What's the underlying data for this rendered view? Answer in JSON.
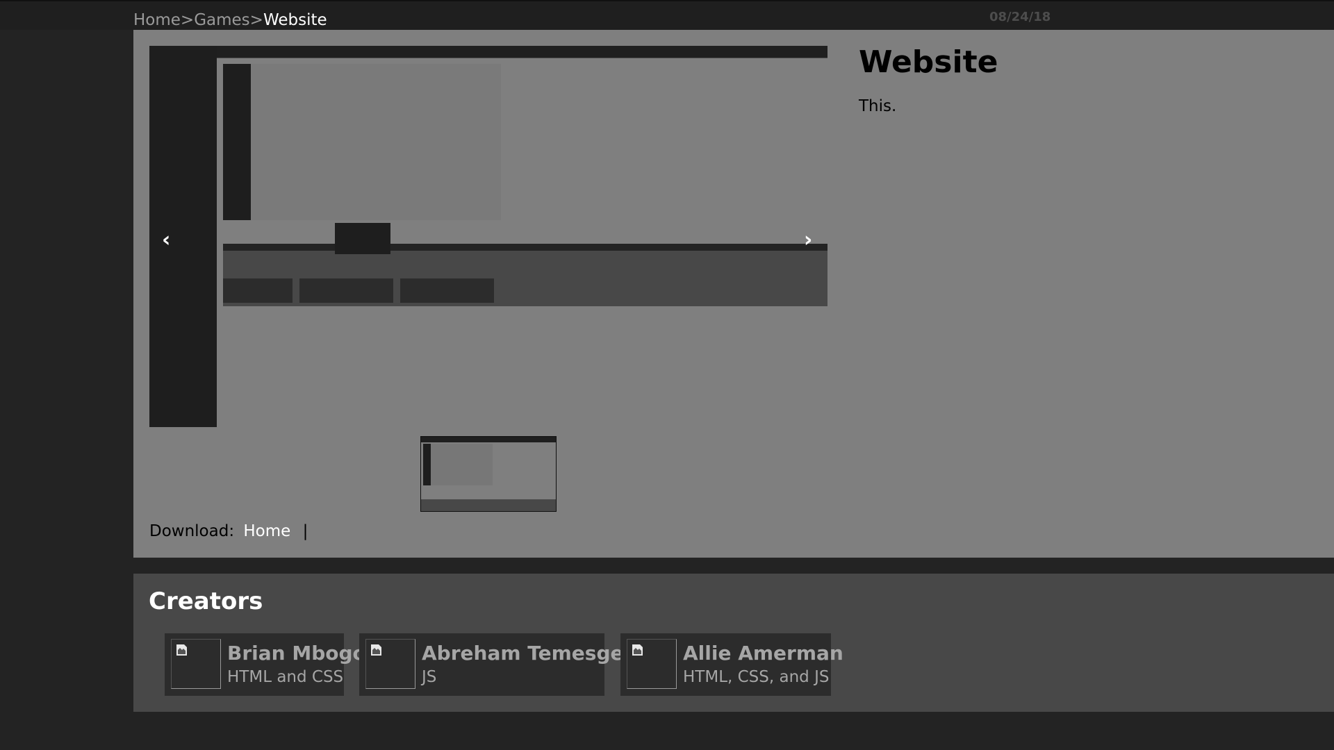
{
  "breadcrumb": {
    "home": "Home",
    "sep1": ">",
    "games": "Games",
    "sep2": ">",
    "current": "Website"
  },
  "date": "08/24/18",
  "carousel": {
    "prev": "‹",
    "next": "›"
  },
  "item": {
    "title": "Website",
    "description": "This."
  },
  "download": {
    "label": "Download:",
    "link": "Home",
    "separator": "|"
  },
  "creators": {
    "heading": "Creators",
    "people": [
      {
        "name": "Brian Mbogo",
        "role": "HTML and CSS"
      },
      {
        "name": "Abreham Temesgen",
        "role": "JS"
      },
      {
        "name": "Allie Amerman",
        "role": "HTML, CSS, and JS"
      }
    ]
  },
  "colors": {
    "page_bg": "#232323",
    "panel_bg": "#7f7f7f",
    "creators_bg": "#484848",
    "card_bg": "#2c2c2c",
    "link": "#ffffff"
  },
  "icons": {
    "carousel_prev": "chevron-left-icon",
    "carousel_next": "chevron-right-icon",
    "avatar": "broken-image-icon"
  }
}
